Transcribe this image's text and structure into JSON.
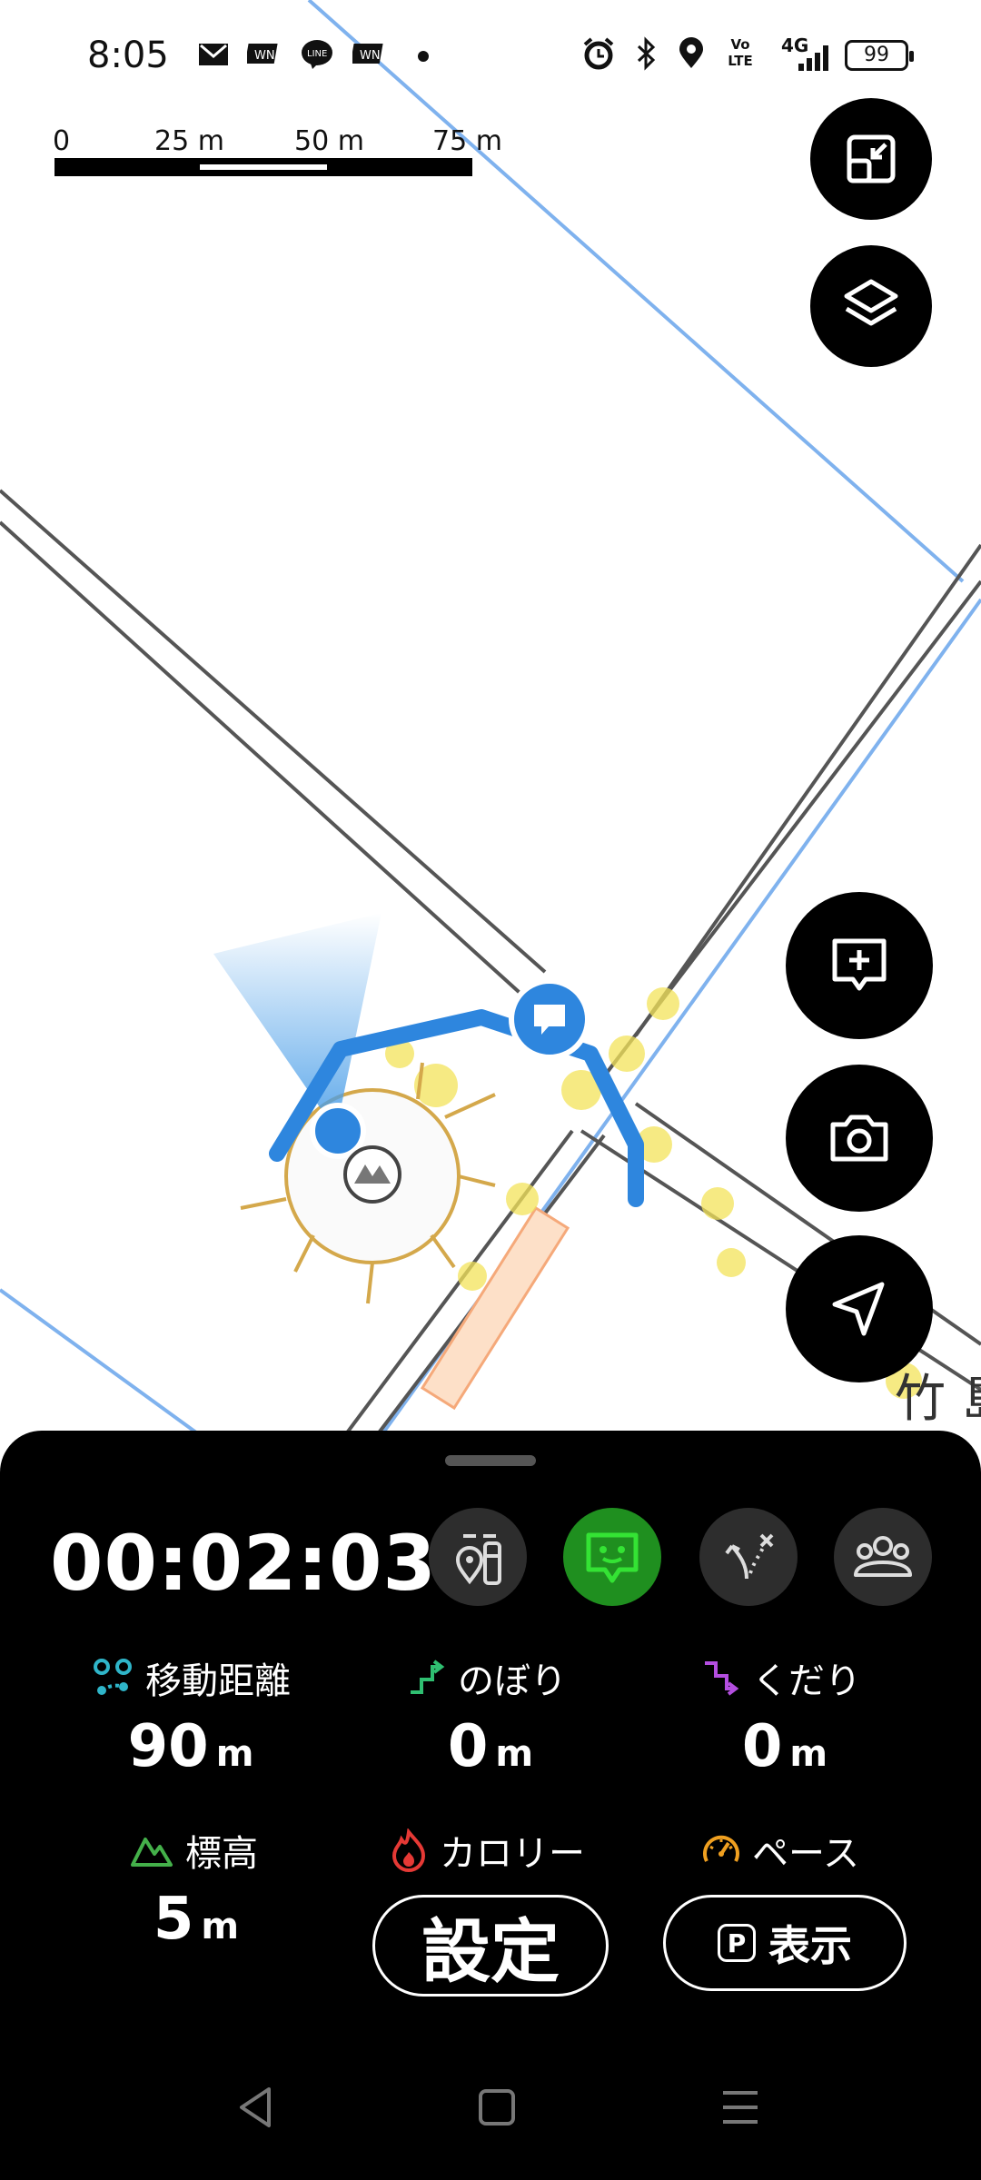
{
  "status_bar": {
    "time": "8:05",
    "battery": "99",
    "notification_icons": [
      "mail-icon",
      "wn-icon",
      "line-icon",
      "wn-icon",
      "dot-icon"
    ],
    "system_icons": [
      "alarm-icon",
      "bluetooth-icon",
      "location-icon",
      "volte-icon",
      "signal-4g-icon",
      "battery-icon"
    ],
    "volte_label": "Vo LTE",
    "network_label": "4G"
  },
  "map": {
    "scale_labels": [
      "0",
      "25 m",
      "50 m",
      "75 m"
    ],
    "place_label": "竹 島",
    "colors": {
      "route": "#2e86de",
      "road_edge": "#555555",
      "boundary": "#7fb2ee",
      "footprint": "#f3e35a",
      "sun": "#d4a84b"
    }
  },
  "map_buttons": [
    "exit-fullscreen-icon",
    "layers-icon",
    "add-note-icon",
    "camera-icon",
    "navigate-icon"
  ],
  "sheet": {
    "timer": "00:02:03",
    "tools": [
      "map-pin-bottles-icon",
      "chat-face-icon",
      "route-icon",
      "group-icon"
    ],
    "stats": {
      "distance": {
        "label": "移動距離",
        "value": "90",
        "unit": "m"
      },
      "ascent": {
        "label": "のぼり",
        "value": "0",
        "unit": "m"
      },
      "descent": {
        "label": "くだり",
        "value": "0",
        "unit": "m"
      },
      "elevation": {
        "label": "標高",
        "value": "5",
        "unit": "m"
      },
      "calorie": {
        "label": "カロリー"
      },
      "pace": {
        "label": "ペース"
      }
    },
    "settings_button": "設定",
    "show_button": "表示",
    "show_button_badge": "P",
    "accent_colors": {
      "distance": "#2fb5c9",
      "ascent": "#2fbf71",
      "descent": "#b44ee0",
      "elevation": "#44b04a",
      "calorie": "#e53935",
      "pace": "#f0a020",
      "active_tool": "#1f8f1f",
      "active_icon": "#34e334"
    }
  },
  "nav_bar": [
    "back-icon",
    "home-icon",
    "menu-icon"
  ]
}
